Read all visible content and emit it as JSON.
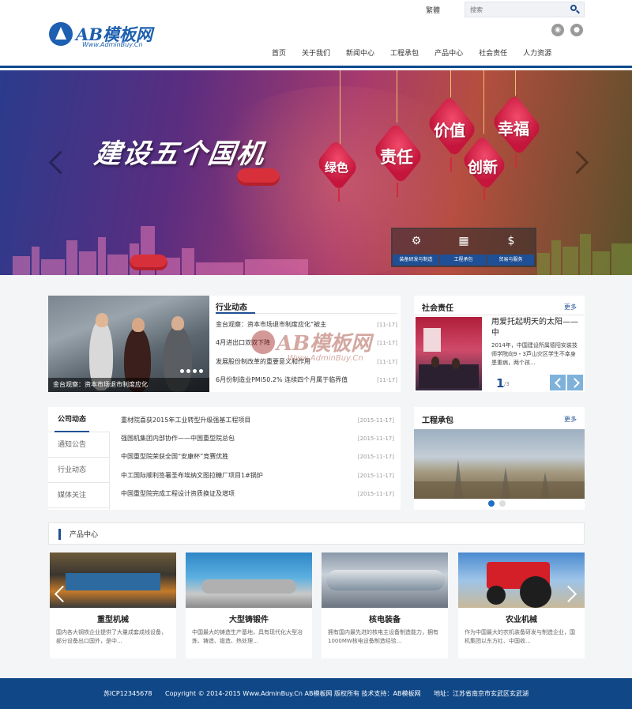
{
  "header": {
    "logo_text": "AB模板网",
    "logo_sub": "Www.AdminBuy.Cn",
    "top_link": "繁體",
    "search_placeholder": "搜索",
    "social_icons": [
      "weibo-icon",
      "wechat-icon"
    ],
    "nav": [
      "首页",
      "关于我们",
      "新闻中心",
      "工程承包",
      "产品中心",
      "社会责任",
      "人力资源"
    ]
  },
  "banner": {
    "title": "建设五个国机",
    "lanterns": [
      "绿色",
      "责任",
      "价值",
      "创新",
      "幸福"
    ],
    "actions": [
      "装备研发与制造",
      "工程承包",
      "贸易与服务"
    ],
    "action_icons": [
      "gears-icon",
      "factory-icon",
      "money-bag-icon"
    ]
  },
  "industry": {
    "title": "行业动态",
    "caption": "金台观察：资本市场退市制度应化",
    "items": [
      {
        "title": "金台观察：资本市场退市制度应化“被主",
        "date": "[11-17]"
      },
      {
        "title": "4月进出口双双下降",
        "date": "[11-17]"
      },
      {
        "title": "发展股份制改革的重要意义和作用",
        "date": "[11-17]"
      },
      {
        "title": "6月份制造业PMI50.2% 连续四个月属于临界值",
        "date": "[11-17]"
      }
    ]
  },
  "social": {
    "title": "社会责任",
    "more": "更多",
    "headline": "用爱托起明天的太阳——中",
    "body": "2014年，中国建设所属德阳安装技师学院向9・3芦山灾区学生不幸身患重病，两个孩...",
    "page": "1",
    "page_total": "/3"
  },
  "company": {
    "tabs": [
      "公司动态",
      "通知公告",
      "行业动态",
      "媒体关注"
    ],
    "items": [
      {
        "title": "重材院喜获2015年工业转型升级强基工程项目",
        "date": "[2015-11-17]"
      },
      {
        "title": "强国机集团内部协作——中国重型院总包",
        "date": "[2015-11-17]"
      },
      {
        "title": "中国重型院荣获全国“安康杯”竞赛优胜",
        "date": "[2015-11-17]"
      },
      {
        "title": "中工国际顺利签署圣布埃纳文图拉糖厂项目1#锅炉",
        "date": "[2015-11-17]"
      },
      {
        "title": "中国重型院完成工程设计资质换证及增项",
        "date": "[2015-11-17]"
      }
    ]
  },
  "engineering": {
    "title": "工程承包",
    "more": "更多"
  },
  "products": {
    "title": "产品中心",
    "items": [
      {
        "name": "重型机械",
        "desc": "国内各大钢铁企业提供了大量成套成线设备，部分设备出口国外，是中..."
      },
      {
        "name": "大型铸锻件",
        "desc": "中国最大的铸造生产基地，具有现代化大型冶炼、铸造、锻造、热处理..."
      },
      {
        "name": "核电装备",
        "desc": "拥有国内最先进的核电主设备制造能力，拥有1000MW核电设备制造经验..."
      },
      {
        "name": "农业机械",
        "desc": "作为中国最大的农机装备研发与制造企业，国机集团以东方红、中国收..."
      }
    ]
  },
  "footer": {
    "icp": "苏ICP12345678",
    "copyright": "Copyright © 2014-2015 Www.AdminBuy.Cn AB模板网 版权所有 技术支持：AB模板网",
    "address": "地址：江苏省南京市玄武区玄武湖"
  },
  "watermark": {
    "brand": "AB模板网",
    "sub": "Www.AdminBuy.Cn"
  }
}
